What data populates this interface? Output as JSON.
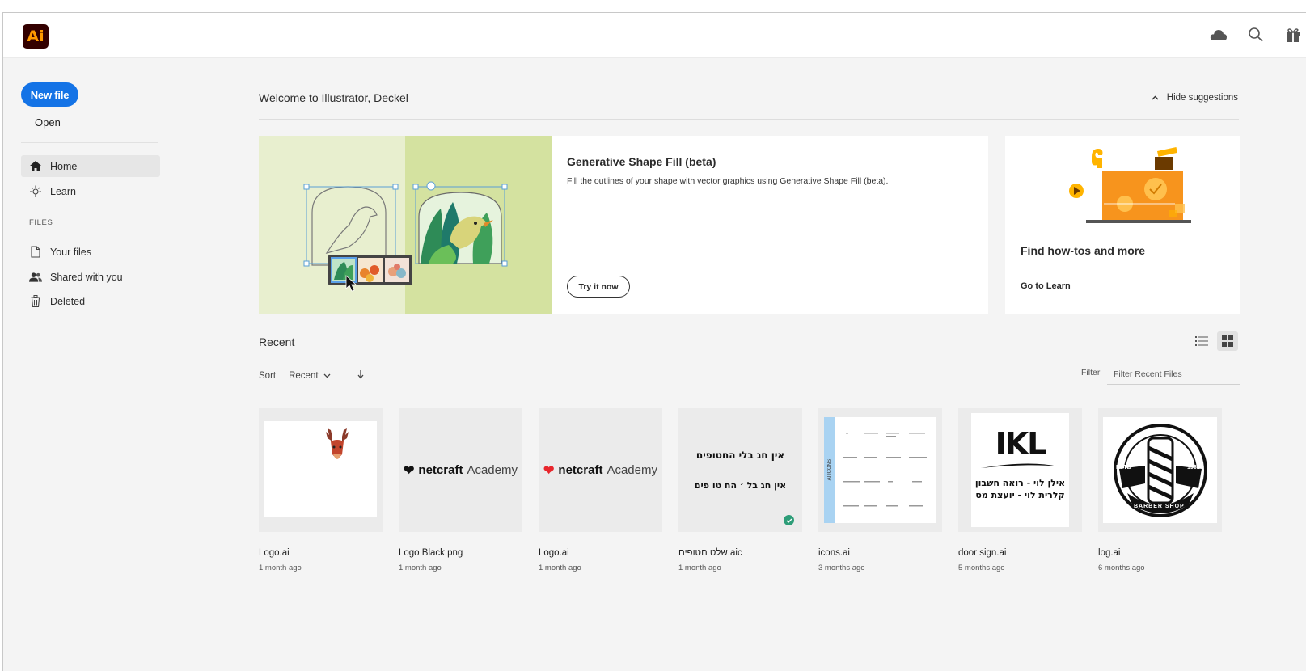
{
  "app": {
    "logo_text": "Ai",
    "brand_bg": "#330000",
    "brand_fg": "#ff9a00",
    "accent": "#1473e6"
  },
  "top_icons": [
    "cloud-icon",
    "search-icon",
    "gift-icon"
  ],
  "sidebar": {
    "new_file": "New file",
    "open": "Open",
    "nav": [
      {
        "label": "Home",
        "icon": "home-icon",
        "active": true
      },
      {
        "label": "Learn",
        "icon": "lightbulb-icon",
        "active": false
      }
    ],
    "files_header": "FILES",
    "files_nav": [
      {
        "label": "Your files",
        "icon": "file-icon"
      },
      {
        "label": "Shared with you",
        "icon": "people-icon"
      },
      {
        "label": "Deleted",
        "icon": "trash-icon"
      }
    ]
  },
  "main": {
    "welcome": "Welcome to Illustrator, Deckel",
    "hide_suggestions": "Hide suggestions",
    "promo": {
      "title": "Generative Shape Fill (beta)",
      "description": "Fill the outlines of your shape with vector graphics using Generative Shape Fill (beta).",
      "button": "Try it now"
    },
    "learn_card": {
      "title": "Find how-tos and more",
      "link": "Go to Learn"
    },
    "recent_title": "Recent",
    "sort_label": "Sort",
    "sort_value": "Recent",
    "filter_label": "Filter",
    "filter_placeholder": "Filter Recent Files",
    "files": [
      {
        "name": "Logo.ai",
        "date": "1 month ago"
      },
      {
        "name": "Logo Black.png",
        "date": "1 month ago",
        "thumb_text": "netcraft",
        "thumb_sub": "Academy"
      },
      {
        "name": "Logo.ai",
        "date": "1 month ago",
        "thumb_text": "netcraft",
        "thumb_sub": "Academy"
      },
      {
        "name": "שלט חטופים.aic",
        "date": "1 month ago",
        "thumb_line1": "אין חג בלי החטופים",
        "thumb_line2": "אין חג בל ׳ הח טו פים"
      },
      {
        "name": "icons.ai",
        "date": "3 months ago",
        "thumb_side": "AI ICONS"
      },
      {
        "name": "door sign.ai",
        "date": "5 months ago",
        "thumb_big": "IKL",
        "thumb_line1": "אילן לוי - רואה חשבון",
        "thumb_line2": "קלרית לוי - יועצת מס"
      },
      {
        "name": "log.ai",
        "date": "6 months ago",
        "thumb_badge": "BARBER SHOP",
        "thumb_left": "ESTB",
        "thumb_right": "1961"
      }
    ]
  }
}
